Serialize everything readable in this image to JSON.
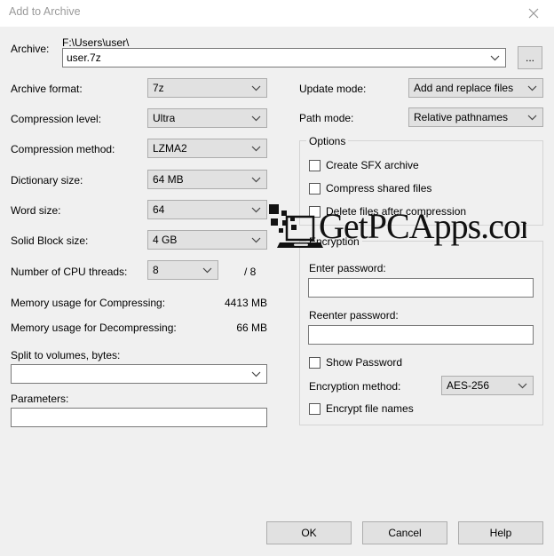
{
  "window": {
    "title": "Add to Archive",
    "close_icon": "close-icon"
  },
  "archive": {
    "label": "Archive:",
    "path": "F:\\Users\\user\\",
    "filename": "user.7z",
    "browse_label": "..."
  },
  "left_column": {
    "archive_format": {
      "label": "Archive format:",
      "value": "7z"
    },
    "compression_level": {
      "label": "Compression level:",
      "value": "Ultra"
    },
    "compression_method": {
      "label": "Compression method:",
      "value": "LZMA2"
    },
    "dictionary_size": {
      "label": "Dictionary size:",
      "value": "64 MB"
    },
    "word_size": {
      "label": "Word size:",
      "value": "64"
    },
    "solid_block_size": {
      "label": "Solid Block size:",
      "value": "4 GB"
    },
    "cpu_threads": {
      "label": "Number of CPU threads:",
      "value": "8",
      "total": "/ 8"
    },
    "memory_compressing": {
      "label": "Memory usage for Compressing:",
      "value": "4413 MB"
    },
    "memory_decompressing": {
      "label": "Memory usage for Decompressing:",
      "value": "66 MB"
    },
    "split_volumes": {
      "label": "Split to volumes, bytes:",
      "value": ""
    },
    "parameters": {
      "label": "Parameters:",
      "value": ""
    }
  },
  "right_column": {
    "update_mode": {
      "label": "Update mode:",
      "value": "Add and replace files"
    },
    "path_mode": {
      "label": "Path mode:",
      "value": "Relative pathnames"
    },
    "options": {
      "title": "Options",
      "items": [
        {
          "label": "Create SFX archive",
          "checked": false
        },
        {
          "label": "Compress shared files",
          "checked": false
        },
        {
          "label": "Delete files after compression",
          "checked": false
        }
      ]
    },
    "encryption": {
      "title": "Encryption",
      "enter_password_label": "Enter password:",
      "enter_password_value": "",
      "reenter_password_label": "Reenter password:",
      "reenter_password_value": "",
      "show_password": {
        "label": "Show Password",
        "checked": false
      },
      "method_label": "Encryption method:",
      "method_value": "AES-256",
      "encrypt_file_names": {
        "label": "Encrypt file names",
        "checked": false
      }
    }
  },
  "footer": {
    "ok_label": "OK",
    "cancel_label": "Cancel",
    "help_label": "Help"
  },
  "watermark": {
    "text": "GetPCApps.com",
    "logo": "laptop-icon"
  },
  "colors": {
    "dialog_bg": "#f0f0f0",
    "titlebar_bg": "#ffffff",
    "title_text": "#9a9a9a",
    "control_bg": "#e1e1e1",
    "control_border": "#adadad",
    "field_bg": "#ffffff",
    "field_border": "#7a7a7a",
    "group_border": "#d4d4d4",
    "text": "#000000"
  }
}
